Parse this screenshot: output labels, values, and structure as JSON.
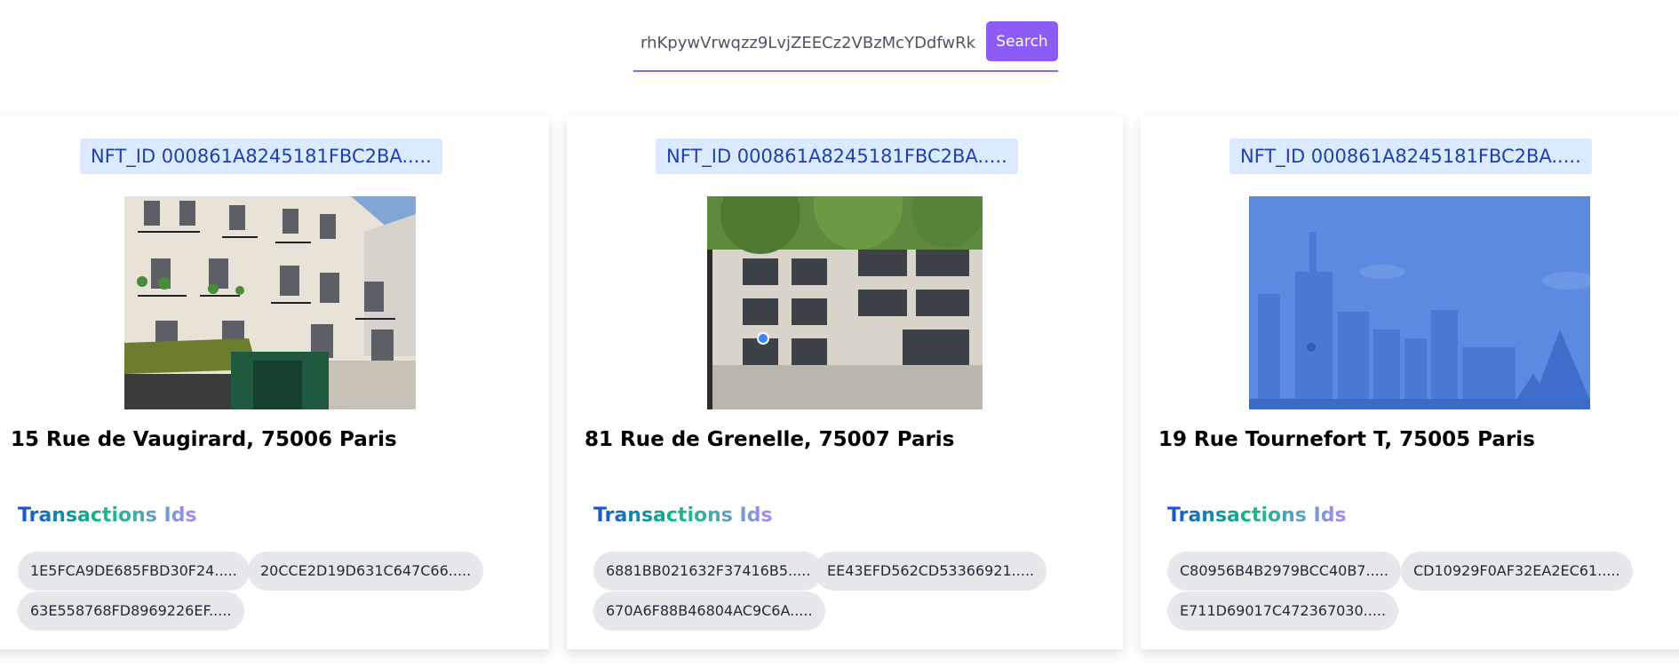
{
  "search": {
    "value": "rhKpywVrwqzz9LvjZEECz2VBzMcYDdfwRk",
    "button_label": "Search"
  },
  "colors": {
    "accent": "#8b5cf6",
    "badge_bg": "#dbeafe",
    "badge_text": "#1e40af",
    "chip_bg": "#e5e7eb"
  },
  "cards": [
    {
      "nft_id": "NFT_ID 000861A8245181FBC2BA.....",
      "image": "street-view-building-photo",
      "address": "15 Rue de Vaugirard, 75006 Paris",
      "transactions_heading": "Transactions Ids",
      "transactions": [
        "1E5FCA9DE685FBD30F24.....",
        "20CCE2D19D631C647C66.....",
        "63E558768FD8969226EF....."
      ]
    },
    {
      "nft_id": "NFT_ID 000861A8245181FBC2BA.....",
      "image": "street-view-building-photo",
      "address": "81 Rue de Grenelle, 75007 Paris",
      "transactions_heading": "Transactions Ids",
      "transactions": [
        "6881BB021632F37416B5.....",
        "EE43EFD562CD53366921.....",
        "670A6F88B46804AC9C6A....."
      ]
    },
    {
      "nft_id": "NFT_ID 000861A8245181FBC2BA.....",
      "image": "city-placeholder-illustration",
      "address": "19 Rue Tournefort T, 75005 Paris",
      "transactions_heading": "Transactions Ids",
      "transactions": [
        "C80956B4B2979BCC40B7.....",
        "CD10929F0AF32EA2EC61.....",
        "E711D69017C472367030....."
      ]
    }
  ]
}
